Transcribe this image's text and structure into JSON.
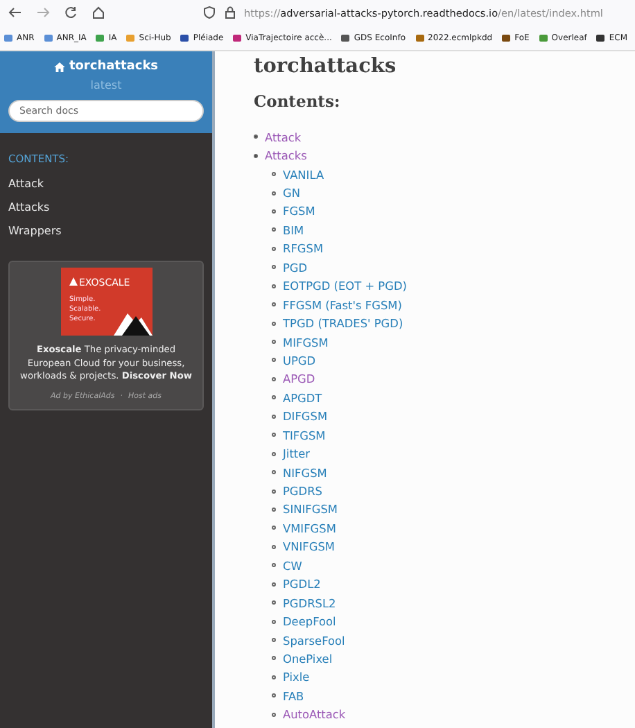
{
  "browser": {
    "url_prefix": "https://",
    "url_domain": "adversarial-attacks-pytorch.readthedocs.io",
    "url_path": "/en/latest/index.html",
    "bookmarks": [
      {
        "label": "ANR",
        "color": "#5b8fd6"
      },
      {
        "label": "ANR_IA",
        "color": "#5b8fd6"
      },
      {
        "label": "IA",
        "color": "#3fa34d"
      },
      {
        "label": "Sci-Hub",
        "color": "#e8a030"
      },
      {
        "label": "Pléiade",
        "color": "#2b4fa8"
      },
      {
        "label": "ViaTrajectoire accè...",
        "color": "#c0287a"
      },
      {
        "label": "GDS EcoInfo",
        "color": "#555555"
      },
      {
        "label": "2022.ecmlpkdd",
        "color": "#a86a10"
      },
      {
        "label": "FoE",
        "color": "#7a4a10"
      },
      {
        "label": "Overleaf",
        "color": "#4a9a3a"
      },
      {
        "label": "ECM",
        "color": "#333333"
      }
    ]
  },
  "sidebar": {
    "project": "torchattacks",
    "version": "latest",
    "search": {
      "placeholder": "Search docs"
    },
    "caption": "CONTENTS:",
    "items": [
      {
        "label": "Attack"
      },
      {
        "label": "Attacks"
      },
      {
        "label": "Wrappers"
      }
    ],
    "ad": {
      "banner_brand": "EXOSCALE",
      "banner_lines": [
        "Simple.",
        "Scalable.",
        "Secure."
      ],
      "text": "**Exoscale** The privacy-minded European Cloud for your business, workloads & projects. **Discover Now**",
      "footer_left": "Ad by EthicalAds",
      "footer_sep": "·",
      "footer_right": "Host ads"
    }
  },
  "main": {
    "title": "torchattacks",
    "subtitle": "Contents:",
    "toc": [
      {
        "label": "Attack",
        "visited": true
      },
      {
        "label": "Attacks",
        "visited": true,
        "children": [
          {
            "label": "VANILA",
            "visited": false
          },
          {
            "label": "GN",
            "visited": false
          },
          {
            "label": "FGSM",
            "visited": false
          },
          {
            "label": "BIM",
            "visited": false
          },
          {
            "label": "RFGSM",
            "visited": false
          },
          {
            "label": "PGD",
            "visited": false
          },
          {
            "label": "EOTPGD (EOT + PGD)",
            "visited": false
          },
          {
            "label": "FFGSM (Fast's FGSM)",
            "visited": false
          },
          {
            "label": "TPGD (TRADES' PGD)",
            "visited": false
          },
          {
            "label": "MIFGSM",
            "visited": false
          },
          {
            "label": "UPGD",
            "visited": false
          },
          {
            "label": "APGD",
            "visited": true
          },
          {
            "label": "APGDT",
            "visited": false
          },
          {
            "label": "DIFGSM",
            "visited": false
          },
          {
            "label": "TIFGSM",
            "visited": false
          },
          {
            "label": "Jitter",
            "visited": false
          },
          {
            "label": "NIFGSM",
            "visited": false
          },
          {
            "label": "PGDRS",
            "visited": false
          },
          {
            "label": "SINIFGSM",
            "visited": false
          },
          {
            "label": "VMIFGSM",
            "visited": false
          },
          {
            "label": "VNIFGSM",
            "visited": false
          },
          {
            "label": "CW",
            "visited": false
          },
          {
            "label": "PGDL2",
            "visited": false
          },
          {
            "label": "PGDRSL2",
            "visited": false
          },
          {
            "label": "DeepFool",
            "visited": false
          },
          {
            "label": "SparseFool",
            "visited": false
          },
          {
            "label": "OnePixel",
            "visited": false
          },
          {
            "label": "Pixle",
            "visited": false
          },
          {
            "label": "FAB",
            "visited": false
          },
          {
            "label": "AutoAttack",
            "visited": true
          }
        ]
      }
    ]
  }
}
